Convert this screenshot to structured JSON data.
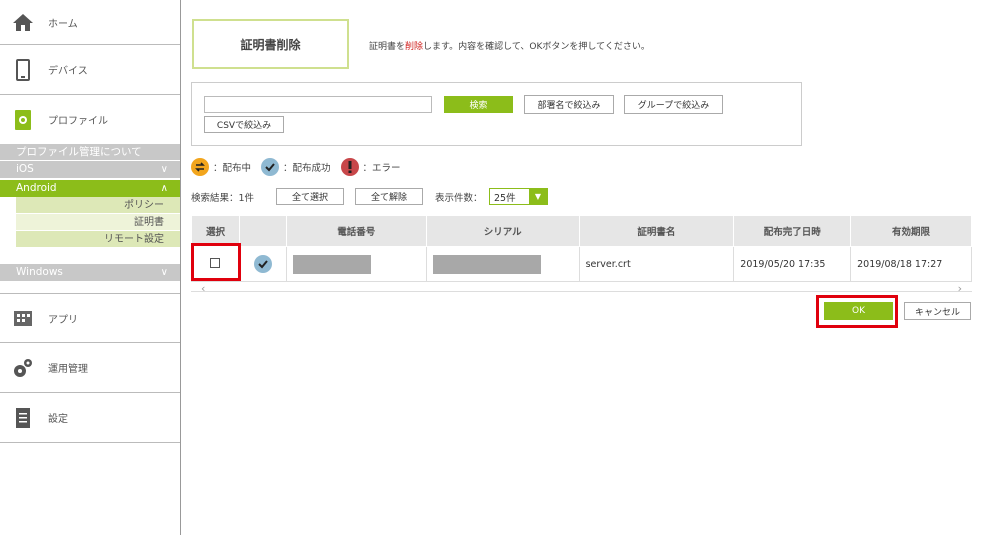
{
  "sidebar": {
    "home": "ホーム",
    "device": "デバイス",
    "profile": "プロファイル",
    "profile_about": "プロファイル管理について",
    "ios": "iOS",
    "android": "Android",
    "android_items": [
      "ポリシー",
      "証明書",
      "リモート設定"
    ],
    "windows": "Windows",
    "apps": "アプリ",
    "operations": "運用管理",
    "settings": "設定"
  },
  "page": {
    "title": "証明書削除",
    "desc_pre": "証明書を",
    "desc_red": "削除",
    "desc_post": "します。内容を確認して、OKボタンを押してください。"
  },
  "search": {
    "input_value": "",
    "search_btn": "検索",
    "dept_btn": "部署名で絞込み",
    "group_btn": "グループで絞込み",
    "csv_btn": "CSVで絞込み"
  },
  "legend": {
    "distributing": "：配布中",
    "success": "：配布成功",
    "error": "：エラー"
  },
  "results": {
    "count": "検索結果：1件",
    "select_all": "全て選択",
    "deselect_all": "全て解除",
    "display_count_label": "表示件数：",
    "display_count": "25件"
  },
  "table": {
    "headers": [
      "選択",
      "",
      "電話番号",
      "シリアル",
      "証明書名",
      "配布完了日時",
      "有効期限"
    ],
    "rows": [
      {
        "cert": "server.crt",
        "completed": "2019/05/20 17:35",
        "expiry": "2019/08/18 17:27"
      }
    ]
  },
  "actions": {
    "ok": "OK",
    "cancel": "キャンセル"
  },
  "colors": {
    "accent_green": "#8cbd1a",
    "highlight_red": "#e0000d"
  }
}
